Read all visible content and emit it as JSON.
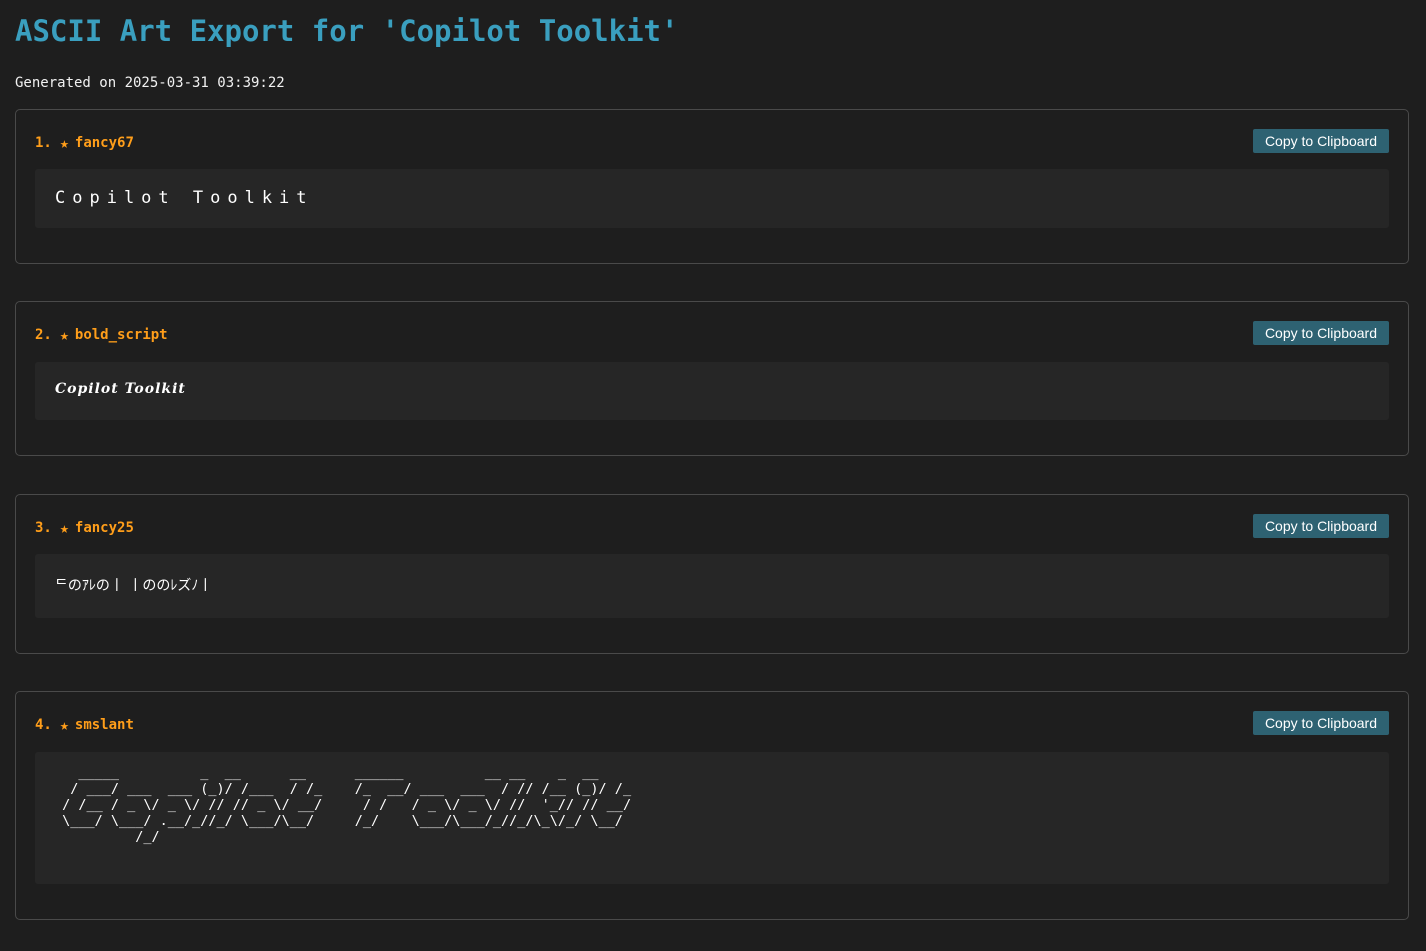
{
  "page": {
    "title": "ASCII Art Export for 'Copilot Toolkit'",
    "generated": "Generated on 2025-03-31 03:39:22"
  },
  "colors": {
    "background": "#1e1e1e",
    "title": "#3a9fbf",
    "header_accent": "#ff9e1a",
    "button": "#2e6272",
    "art_box": "#262626",
    "border": "#4a4a4a"
  },
  "cards": [
    {
      "index": "1.",
      "star": "★",
      "font_name": "fancy67",
      "button_label": "Copy to Clipboard",
      "art": "Copilot Toolkit"
    },
    {
      "index": "2.",
      "star": "★",
      "font_name": "bold_script",
      "button_label": "Copy to Clipboard",
      "art": "Copilot Toolkit"
    },
    {
      "index": "3.",
      "star": "★",
      "font_name": "fancy25",
      "button_label": "Copy to Clipboard",
      "art": "ᄃのｱﾚの丨 丨ののﾚズﾉ丨"
    },
    {
      "index": "4.",
      "star": "★",
      "font_name": "smslant",
      "button_label": "Copy to Clipboard",
      "art": "   _____          _  __      __      ______          __ __    _  __ \n  / ___/ ___  ___ (_)/ /___  / /_    /_  __/ ___  ___  / // /__ (_)/ /_\n / /__ / _ \\/ _ \\/ // // _ \\/ __/     / /   / _ \\/ _ \\/ //  '_// // __/\n \\___/ \\___/ .__/_//_/ \\___/\\__/     /_/    \\___/\\___/_//_/\\_\\/_/ \\__/ \n          /_/                                                          "
    }
  ]
}
